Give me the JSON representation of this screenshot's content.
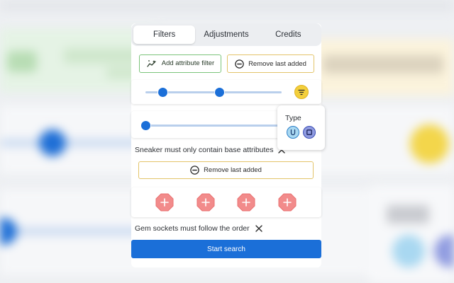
{
  "tabs": [
    {
      "label": "Filters",
      "active": true
    },
    {
      "label": "Adjustments",
      "active": false
    },
    {
      "label": "Credits",
      "active": false
    }
  ],
  "actions": {
    "add_attribute_filter": "Add attribute filter",
    "remove_last_added": "Remove last added"
  },
  "popover": {
    "title": "Type"
  },
  "rules": {
    "base_attributes": "Sneaker must only contain base attributes",
    "remove_last_added": "Remove last added",
    "gem_sockets": "Gem sockets must follow the order"
  },
  "sockets": [
    "plus-icon",
    "plus-icon",
    "plus-icon",
    "plus-icon"
  ],
  "search": {
    "label": "Start search"
  },
  "colors": {
    "primary": "#1b6fd8",
    "success_border": "#7bc47a",
    "warning_border": "#e3c46a",
    "toggle_yellow": "#f3cf3c",
    "socket_red": "#f28b8b",
    "type_uncommon": "#a9d8f1",
    "type_rare": "#8f9be0"
  }
}
